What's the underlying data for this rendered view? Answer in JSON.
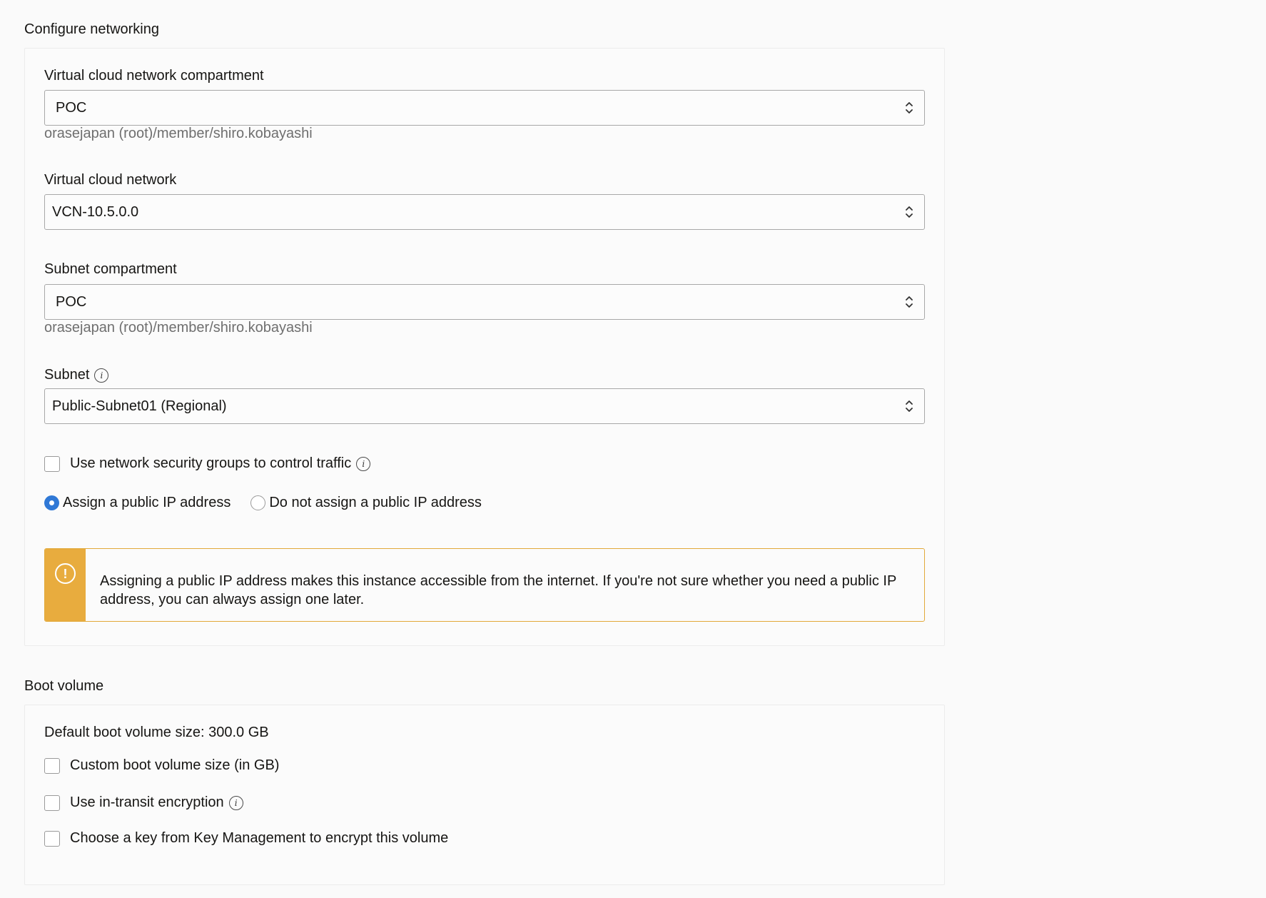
{
  "networking": {
    "section_title": "Configure networking",
    "vcn_compartment": {
      "label": "Virtual cloud network compartment",
      "value": "POC",
      "path": "orasejapan (root)/member/shiro.kobayashi"
    },
    "vcn": {
      "label": "Virtual cloud network",
      "value": "VCN-10.5.0.0"
    },
    "subnet_compartment": {
      "label": "Subnet compartment",
      "value": "POC",
      "path": "orasejapan (root)/member/shiro.kobayashi"
    },
    "subnet": {
      "label": "Subnet",
      "value": "Public-Subnet01 (Regional)"
    },
    "nsg_checkbox": {
      "label": "Use network security groups to control traffic",
      "checked": false
    },
    "public_ip": {
      "options": [
        "Assign a public IP address",
        "Do not assign a public IP address"
      ],
      "selected": "Assign a public IP address"
    },
    "warning": {
      "icon": "exclamation-circle-icon",
      "text": "Assigning a public IP address makes this instance accessible from the internet. If you're not sure whether you need a public IP address, you can always assign one later.",
      "color": "#e8ac3e"
    }
  },
  "boot_volume": {
    "section_title": "Boot volume",
    "default_size": "Default boot volume size: 300.0 GB",
    "options": [
      {
        "label": "Custom boot volume size (in GB)",
        "checked": false
      },
      {
        "label": "Use in-transit encryption",
        "checked": false
      },
      {
        "label": "Choose a key from Key Management to encrypt this volume",
        "checked": false
      }
    ]
  },
  "colors": {
    "accent_blue": "#2f78d6",
    "warning_orange": "#e8ac3e"
  }
}
